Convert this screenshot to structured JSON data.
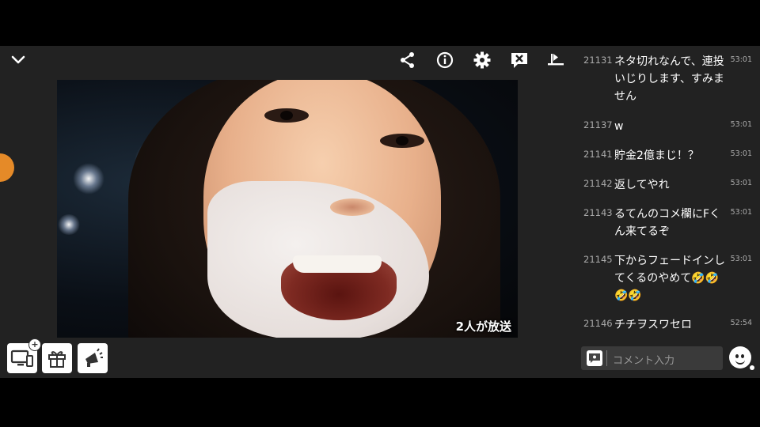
{
  "toolbar": {
    "collapse_icon": "chevron-down-icon",
    "icons": [
      "share-icon",
      "info-icon",
      "gear-icon",
      "hide-comments-icon",
      "exit-icon"
    ]
  },
  "video": {
    "stream_count": "2人が放送"
  },
  "bottom_buttons": [
    "tv-add-icon",
    "gift-icon",
    "megaphone-icon"
  ],
  "comments": [
    {
      "num": "21131",
      "text": "ネタ切れなんで、連投いじりします、すみません",
      "time": "53:01"
    },
    {
      "num": "21137",
      "text": "w",
      "time": "53:01"
    },
    {
      "num": "21141",
      "text": "貯金2億まじ！？",
      "time": "53:01"
    },
    {
      "num": "21142",
      "text": "返してやれ",
      "time": "53:01"
    },
    {
      "num": "21143",
      "text": "るてんのコメ欄にFくん来てるぞ",
      "time": "53:01"
    },
    {
      "num": "21145",
      "text": "下からフェードインしてくるのやめて🤣🤣🤣🤣",
      "time": "53:01"
    },
    {
      "num": "21146",
      "text": "チチヲスワセロ",
      "time": "52:54"
    }
  ],
  "comment_input": {
    "placeholder": "コメント入力"
  },
  "colors": {
    "background": "#222222",
    "accent_orange": "#e58a28"
  }
}
